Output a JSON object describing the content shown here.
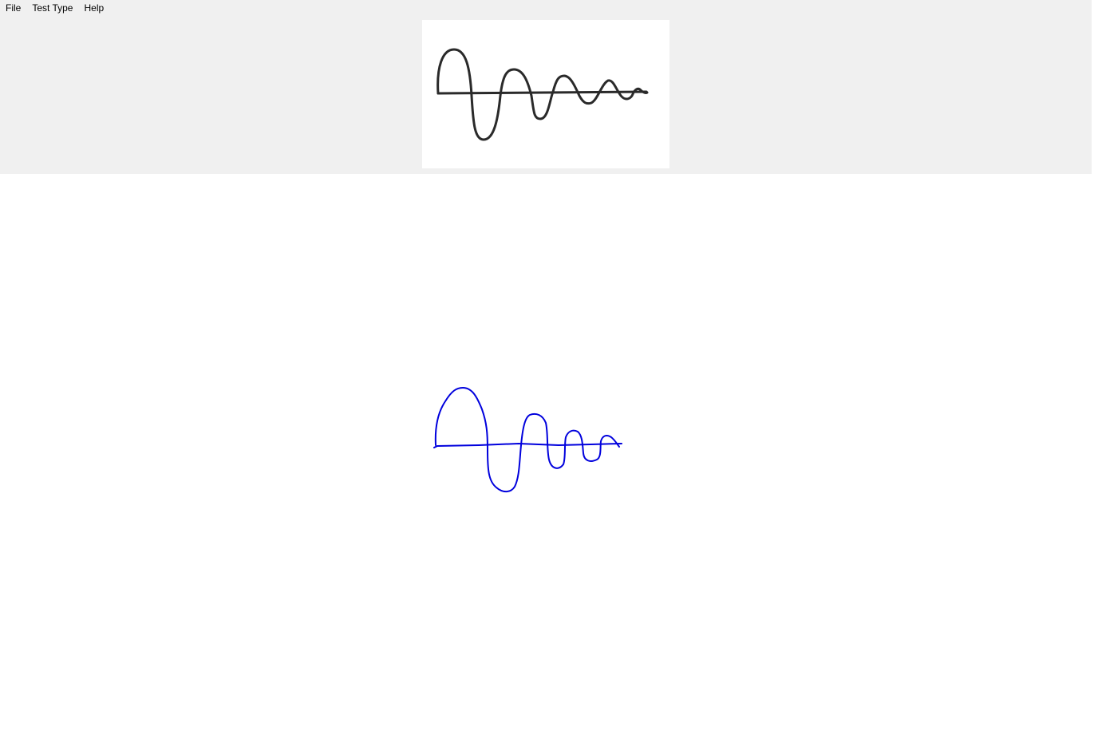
{
  "menu": {
    "items": [
      {
        "label": "File"
      },
      {
        "label": "Test Type"
      },
      {
        "label": "Help"
      }
    ]
  },
  "reference": {
    "stroke_color": "#2a2a2a"
  },
  "drawing": {
    "stroke_color": "#0000dd"
  }
}
